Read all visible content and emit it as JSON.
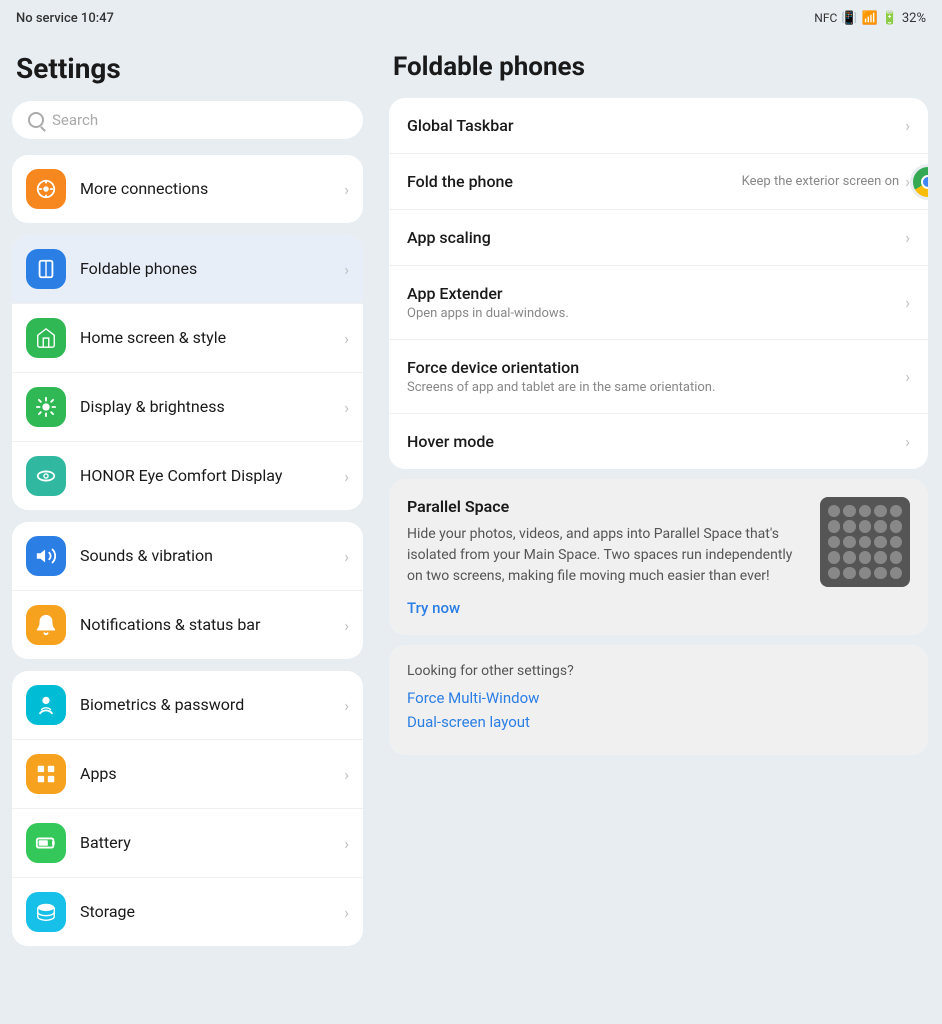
{
  "statusBar": {
    "left": "No service  10:47",
    "battery": "32%"
  },
  "sidebar": {
    "title": "Settings",
    "search": {
      "placeholder": "Search"
    },
    "groups": [
      {
        "items": [
          {
            "id": "more-connections",
            "label": "More connections",
            "iconColor": "icon-orange",
            "iconSymbol": "🔗"
          }
        ]
      },
      {
        "items": [
          {
            "id": "foldable-phones",
            "label": "Foldable phones",
            "iconColor": "icon-blue",
            "iconSymbol": "📱",
            "active": true
          },
          {
            "id": "home-screen",
            "label": "Home screen & style",
            "iconColor": "icon-green2",
            "iconSymbol": "⊞"
          },
          {
            "id": "display-brightness",
            "label": "Display & brightness",
            "iconColor": "icon-green2",
            "iconSymbol": "☀"
          },
          {
            "id": "honor-eye",
            "label": "HONOR Eye Comfort Display",
            "iconColor": "icon-teal",
            "iconSymbol": "👁"
          }
        ]
      },
      {
        "items": [
          {
            "id": "sounds-vibration",
            "label": "Sounds & vibration",
            "iconColor": "icon-blue",
            "iconSymbol": "🔊"
          },
          {
            "id": "notifications",
            "label": "Notifications & status bar",
            "iconColor": "icon-orange2",
            "iconSymbol": "🔔"
          }
        ]
      },
      {
        "items": [
          {
            "id": "biometrics",
            "label": "Biometrics & password",
            "iconColor": "icon-teal2",
            "iconSymbol": "🔑"
          },
          {
            "id": "apps",
            "label": "Apps",
            "iconColor": "icon-orange2",
            "iconSymbol": "⊞"
          },
          {
            "id": "battery",
            "label": "Battery",
            "iconColor": "icon-green",
            "iconSymbol": "🔋"
          },
          {
            "id": "storage",
            "label": "Storage",
            "iconColor": "icon-cyan",
            "iconSymbol": "💾"
          }
        ]
      }
    ]
  },
  "rightPanel": {
    "title": "Foldable phones",
    "items": [
      {
        "id": "global-taskbar",
        "title": "Global Taskbar",
        "subtitle": null,
        "rightText": null
      },
      {
        "id": "fold-phone",
        "title": "Fold the phone",
        "subtitle": null,
        "rightText": "Keep the exterior screen on"
      },
      {
        "id": "app-scaling",
        "title": "App scaling",
        "subtitle": null,
        "rightText": null
      },
      {
        "id": "app-extender",
        "title": "App Extender",
        "subtitle": "Open apps in dual-windows.",
        "rightText": null
      },
      {
        "id": "force-device-orientation",
        "title": "Force device orientation",
        "subtitle": "Screens of app and tablet are in the same orientation.",
        "rightText": null
      },
      {
        "id": "hover-mode",
        "title": "Hover mode",
        "subtitle": null,
        "rightText": null
      }
    ],
    "parallelSpace": {
      "title": "Parallel Space",
      "description": "Hide your photos, videos, and apps into Parallel Space that's isolated from your Main Space. Two spaces run independently on two screens, making file moving much easier than ever!",
      "tryNow": "Try now"
    },
    "otherSettings": {
      "title": "Looking for other settings?",
      "links": [
        "Force Multi-Window",
        "Dual-screen layout"
      ]
    }
  }
}
